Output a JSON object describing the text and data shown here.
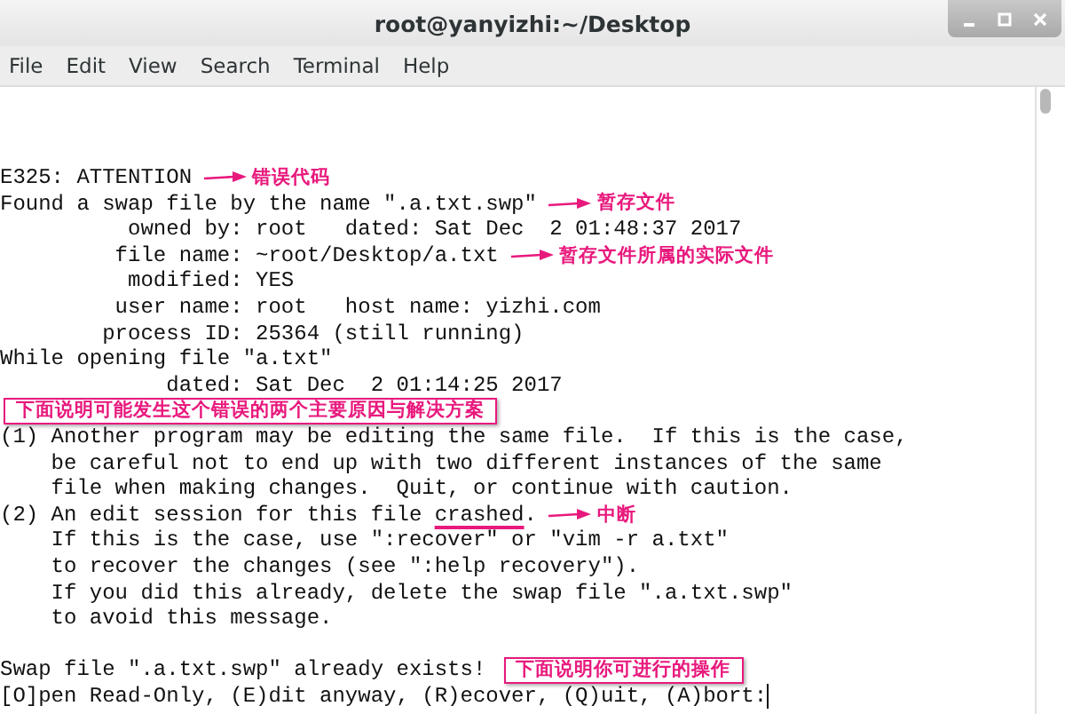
{
  "window": {
    "title": "root@yanyizhi:~/Desktop"
  },
  "menu": [
    {
      "label": "File"
    },
    {
      "label": "Edit"
    },
    {
      "label": "View"
    },
    {
      "label": "Search"
    },
    {
      "label": "Terminal"
    },
    {
      "label": "Help"
    }
  ],
  "terminal": {
    "lines": [
      {
        "kind": "text",
        "parts": [
          {
            "text": "E325: ATTENTION"
          }
        ],
        "note": {
          "kind": "arrow",
          "text": "错误代码"
        }
      },
      {
        "kind": "text",
        "parts": [
          {
            "text": "Found a swap file by the name \".a.txt.swp\""
          }
        ],
        "note": {
          "kind": "arrow",
          "text": "暂存文件"
        }
      },
      {
        "kind": "text",
        "parts": [
          {
            "text": "          owned by: root   dated: Sat Dec  2 01:48:37 2017"
          }
        ]
      },
      {
        "kind": "text",
        "parts": [
          {
            "text": "         file name: ~root/Desktop/a.txt"
          }
        ],
        "note": {
          "kind": "arrow",
          "text": "暂存文件所属的实际文件"
        }
      },
      {
        "kind": "text",
        "parts": [
          {
            "text": "          modified: YES"
          }
        ]
      },
      {
        "kind": "text",
        "parts": [
          {
            "text": "         user name: root   host name: yizhi.com"
          }
        ]
      },
      {
        "kind": "text",
        "parts": [
          {
            "text": "        process ID: 25364 (still running)"
          }
        ]
      },
      {
        "kind": "text",
        "parts": [
          {
            "text": "While opening file \"a.txt\""
          }
        ]
      },
      {
        "kind": "text",
        "parts": [
          {
            "text": "             dated: Sat Dec  2 01:14:25 2017"
          }
        ]
      },
      {
        "kind": "note",
        "note": {
          "kind": "box",
          "text": "下面说明可能发生这个错误的两个主要原因与解决方案"
        }
      },
      {
        "kind": "text",
        "parts": [
          {
            "text": "(1) Another program may be editing the same file.  If this is the case,"
          }
        ]
      },
      {
        "kind": "text",
        "parts": [
          {
            "text": "    be careful not to end up with two different instances of the same"
          }
        ]
      },
      {
        "kind": "text",
        "parts": [
          {
            "text": "    file when making changes.  Quit, or continue with caution."
          }
        ]
      },
      {
        "kind": "text",
        "parts": [
          {
            "text": "(2) An edit session for this file "
          },
          {
            "text": "crashed",
            "underlined": true
          },
          {
            "text": "."
          }
        ],
        "note": {
          "kind": "arrow",
          "text": "中断"
        }
      },
      {
        "kind": "text",
        "parts": [
          {
            "text": "    If this is the case, use \":recover\" or \"vim -r a.txt\""
          }
        ]
      },
      {
        "kind": "text",
        "parts": [
          {
            "text": "    to recover the changes (see \":help recovery\")."
          }
        ]
      },
      {
        "kind": "text",
        "parts": [
          {
            "text": "    If you did this already, delete the swap file \".a.txt.swp\""
          }
        ]
      },
      {
        "kind": "text",
        "parts": [
          {
            "text": "    to avoid this message."
          }
        ]
      },
      {
        "kind": "blank"
      },
      {
        "kind": "text",
        "parts": [
          {
            "text": "Swap file \".a.txt.swp\" already exists!"
          }
        ],
        "note": {
          "kind": "box",
          "text": "下面说明你可进行的操作"
        }
      },
      {
        "kind": "prompt",
        "parts": [
          {
            "text": "[O]pen Read-Only, (E)dit anyway, (R)ecover, (Q)uit, (A)bort:"
          }
        ]
      }
    ]
  }
}
